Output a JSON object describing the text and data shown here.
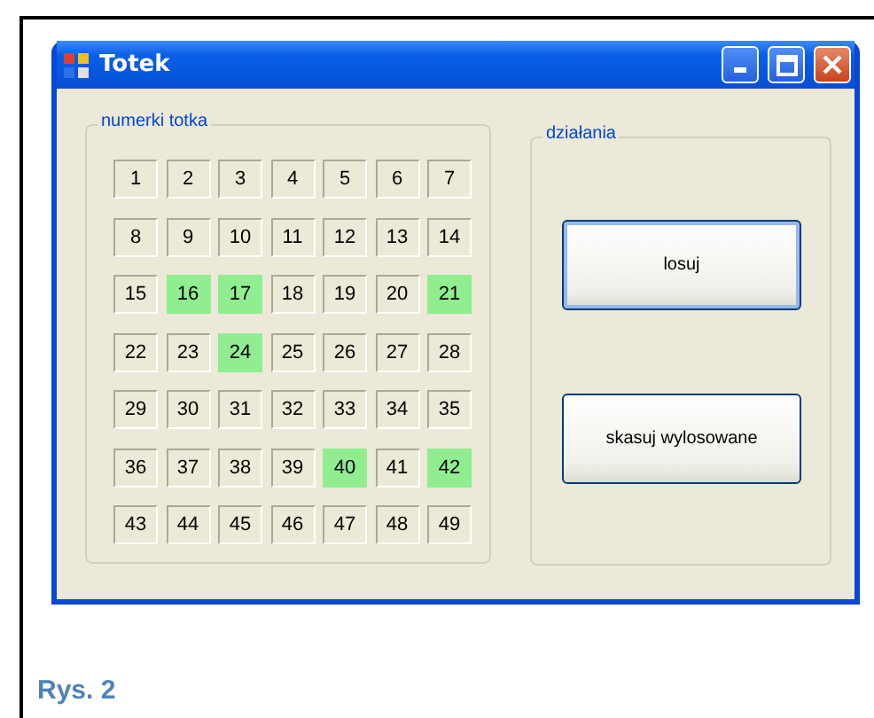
{
  "window": {
    "title": "Totek"
  },
  "numbers_group": {
    "title": "numerki totka",
    "numbers": [
      {
        "label": "1",
        "selected": false
      },
      {
        "label": "2",
        "selected": false
      },
      {
        "label": "3",
        "selected": false
      },
      {
        "label": "4",
        "selected": false
      },
      {
        "label": "5",
        "selected": false
      },
      {
        "label": "6",
        "selected": false
      },
      {
        "label": "7",
        "selected": false
      },
      {
        "label": "8",
        "selected": false
      },
      {
        "label": "9",
        "selected": false
      },
      {
        "label": "10",
        "selected": false
      },
      {
        "label": "11",
        "selected": false
      },
      {
        "label": "12",
        "selected": false
      },
      {
        "label": "13",
        "selected": false
      },
      {
        "label": "14",
        "selected": false
      },
      {
        "label": "15",
        "selected": false
      },
      {
        "label": "16",
        "selected": true
      },
      {
        "label": "17",
        "selected": true
      },
      {
        "label": "18",
        "selected": false
      },
      {
        "label": "19",
        "selected": false
      },
      {
        "label": "20",
        "selected": false
      },
      {
        "label": "21",
        "selected": true
      },
      {
        "label": "22",
        "selected": false
      },
      {
        "label": "23",
        "selected": false
      },
      {
        "label": "24",
        "selected": true
      },
      {
        "label": "25",
        "selected": false
      },
      {
        "label": "26",
        "selected": false
      },
      {
        "label": "27",
        "selected": false
      },
      {
        "label": "28",
        "selected": false
      },
      {
        "label": "29",
        "selected": false
      },
      {
        "label": "30",
        "selected": false
      },
      {
        "label": "31",
        "selected": false
      },
      {
        "label": "32",
        "selected": false
      },
      {
        "label": "33",
        "selected": false
      },
      {
        "label": "34",
        "selected": false
      },
      {
        "label": "35",
        "selected": false
      },
      {
        "label": "36",
        "selected": false
      },
      {
        "label": "37",
        "selected": false
      },
      {
        "label": "38",
        "selected": false
      },
      {
        "label": "39",
        "selected": false
      },
      {
        "label": "40",
        "selected": true
      },
      {
        "label": "41",
        "selected": false
      },
      {
        "label": "42",
        "selected": true
      },
      {
        "label": "43",
        "selected": false
      },
      {
        "label": "44",
        "selected": false
      },
      {
        "label": "45",
        "selected": false
      },
      {
        "label": "46",
        "selected": false
      },
      {
        "label": "47",
        "selected": false
      },
      {
        "label": "48",
        "selected": false
      },
      {
        "label": "49",
        "selected": false
      }
    ]
  },
  "actions_group": {
    "title": "działania",
    "buttons": [
      {
        "label": "losuj",
        "focused": true
      },
      {
        "label": "skasuj wylosowane",
        "focused": false
      }
    ]
  },
  "caption": "Rys. 2"
}
